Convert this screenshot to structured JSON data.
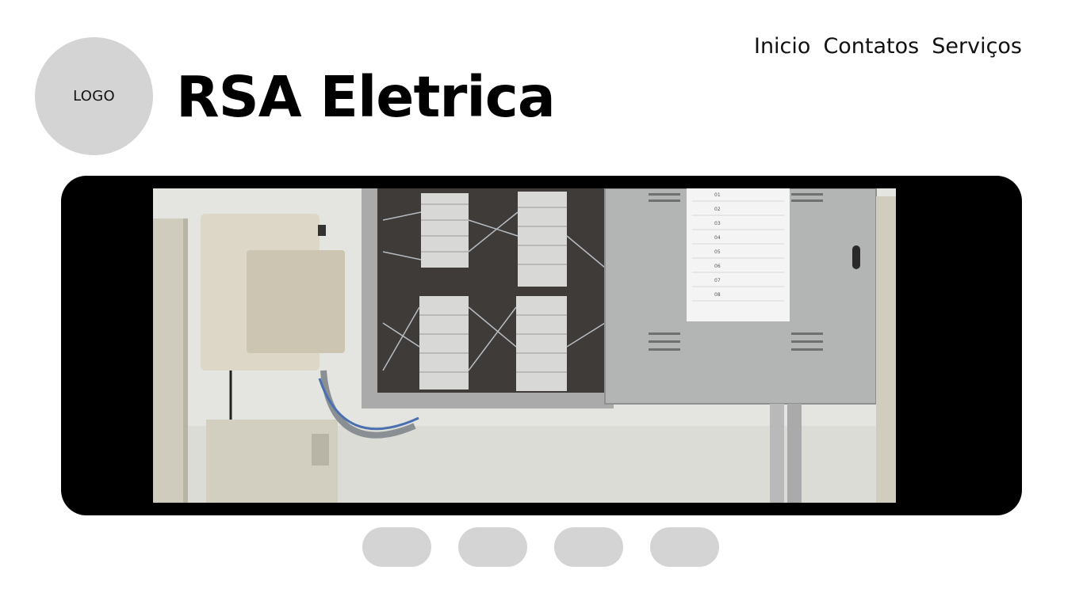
{
  "header": {
    "logo_text": "LOGO",
    "site_title": "RSA Eletrica"
  },
  "nav": {
    "items": [
      {
        "label": "Inicio"
      },
      {
        "label": "Contatos"
      },
      {
        "label": "Serviços"
      }
    ]
  },
  "hero": {
    "panel_labels": [
      "01",
      "02",
      "03",
      "04",
      "05",
      "06",
      "07",
      "08"
    ]
  },
  "carousel": {
    "slide_count": 4
  },
  "colors": {
    "placeholder_gray": "#d4d4d4",
    "hero_frame": "#000000",
    "background": "#ffffff"
  }
}
